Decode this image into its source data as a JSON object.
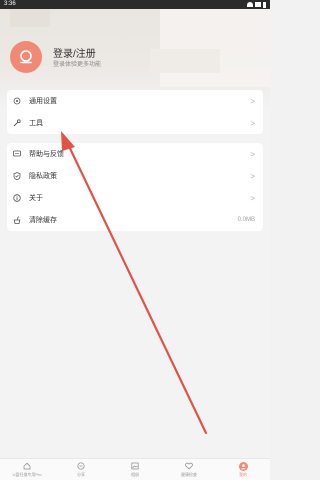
{
  "status_bar": {
    "time": "3:36"
  },
  "profile": {
    "title": "登录/注册",
    "subtitle": "登录体验更多功能"
  },
  "settings_group": [
    {
      "label": "通用设置",
      "icon": "gear-icon"
    },
    {
      "label": "工具",
      "icon": "wrench-icon"
    }
  ],
  "support_group": [
    {
      "label": "帮助与反馈",
      "icon": "chat-icon"
    },
    {
      "label": "隐私政策",
      "icon": "shield-icon"
    },
    {
      "label": "关于",
      "icon": "info-icon"
    },
    {
      "label": "清除缓存",
      "icon": "broom-icon",
      "value": "0.0MB"
    }
  ],
  "chevron": ">",
  "bottom_nav": [
    {
      "label": "U盘扫描专用Pro",
      "icon": "home-icon",
      "active": false
    },
    {
      "label": "分享",
      "icon": "share-icon",
      "active": false
    },
    {
      "label": "相册",
      "icon": "image-icon",
      "active": false
    },
    {
      "label": "健康检查",
      "icon": "heart-icon",
      "active": false
    },
    {
      "label": "我的",
      "icon": "profile-icon",
      "active": true
    }
  ],
  "colors": {
    "accent": "#f08a77",
    "annotation": "#e0534a"
  }
}
